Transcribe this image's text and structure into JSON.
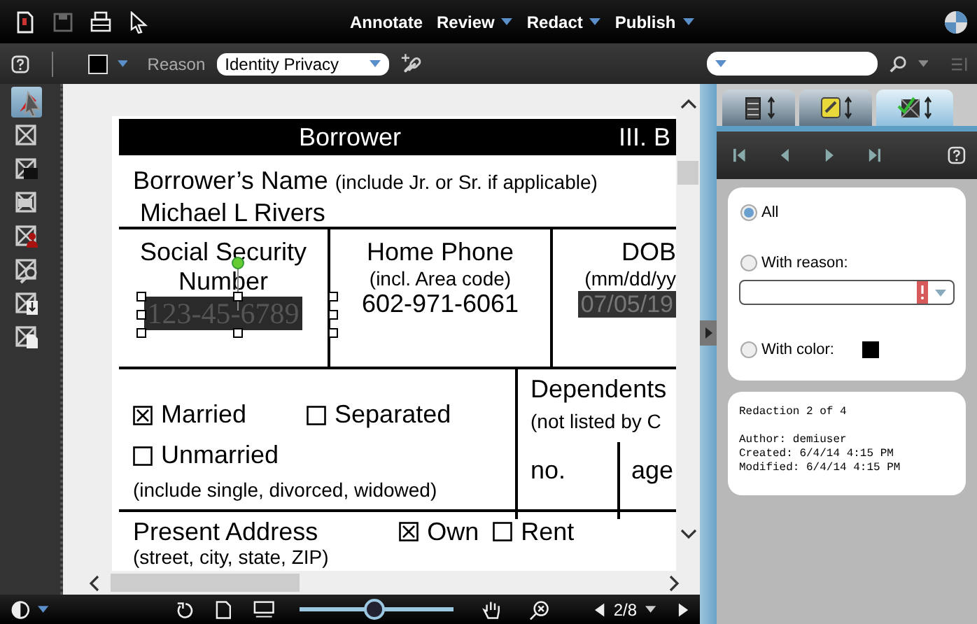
{
  "top_bar": {
    "menu": [
      {
        "label": "Annotate",
        "dropdown": false
      },
      {
        "label": "Review",
        "dropdown": true
      },
      {
        "label": "Redact",
        "dropdown": true
      },
      {
        "label": "Publish",
        "dropdown": true
      }
    ]
  },
  "toolbar": {
    "color": "#000000",
    "reason_label": "Reason",
    "reason_value": "Identity Privacy"
  },
  "tool_rail": {
    "items": [
      {
        "kind": "pointer",
        "selected": true
      },
      {
        "kind": "area",
        "selected": false
      },
      {
        "kind": "text",
        "selected": false
      },
      {
        "kind": "page",
        "selected": false
      },
      {
        "kind": "person",
        "selected": false
      },
      {
        "kind": "search",
        "selected": false
      },
      {
        "kind": "import",
        "selected": false
      },
      {
        "kind": "document",
        "selected": false
      }
    ]
  },
  "document": {
    "header": {
      "title": "Borrower",
      "section": "III. B"
    },
    "name_label": "Borrower’s Name",
    "name_hint": "(include Jr. or Sr. if applicable)",
    "name_value": "Michael L Rivers",
    "cells": [
      {
        "title": "Social Security Number",
        "value": "123-45-6789",
        "redacted": true,
        "selected": true
      },
      {
        "title": "Home Phone",
        "hint": "(incl. Area code)",
        "value": "602-971-6061",
        "redacted": false,
        "selected": false
      },
      {
        "title": "DOB",
        "hint": "(mm/dd/yy",
        "value": "07/05/19",
        "redacted": true,
        "selected": false
      }
    ],
    "marital": [
      {
        "label": "Married",
        "checked": true
      },
      {
        "label": "Separated",
        "checked": false
      },
      {
        "label": "Unmarried",
        "checked": false
      }
    ],
    "marital_note": "(include single, divorced, widowed)",
    "dependents": {
      "title": "Dependents",
      "hint": "(not listed by C",
      "no_label": "no.",
      "age_label": "age"
    },
    "address": {
      "label": "Present Address",
      "hint": "(street, city, state, ZIP)",
      "ownership": [
        {
          "label": "Own",
          "checked": true
        },
        {
          "label": "Rent",
          "checked": false
        }
      ]
    }
  },
  "side_panel": {
    "tabs": [
      {
        "kind": "list",
        "selected": false
      },
      {
        "kind": "note",
        "selected": false
      },
      {
        "kind": "redaction",
        "selected": true
      }
    ],
    "filters": [
      {
        "kind": "plain",
        "label": "All",
        "selected": true
      },
      {
        "kind": "reason",
        "label": "With reason:",
        "selected": false,
        "error": true
      },
      {
        "kind": "color",
        "label": "With color:",
        "selected": false,
        "color": "#000000"
      }
    ],
    "info": {
      "title": "Redaction 2 of 4",
      "lines": [
        "Author: demiuser",
        "Created: 6/4/14 4:15 PM",
        "Modified: 6/4/14 4:15 PM"
      ]
    }
  },
  "bottom_bar": {
    "zoom": {
      "level": 0.48
    },
    "page": "2/8"
  }
}
